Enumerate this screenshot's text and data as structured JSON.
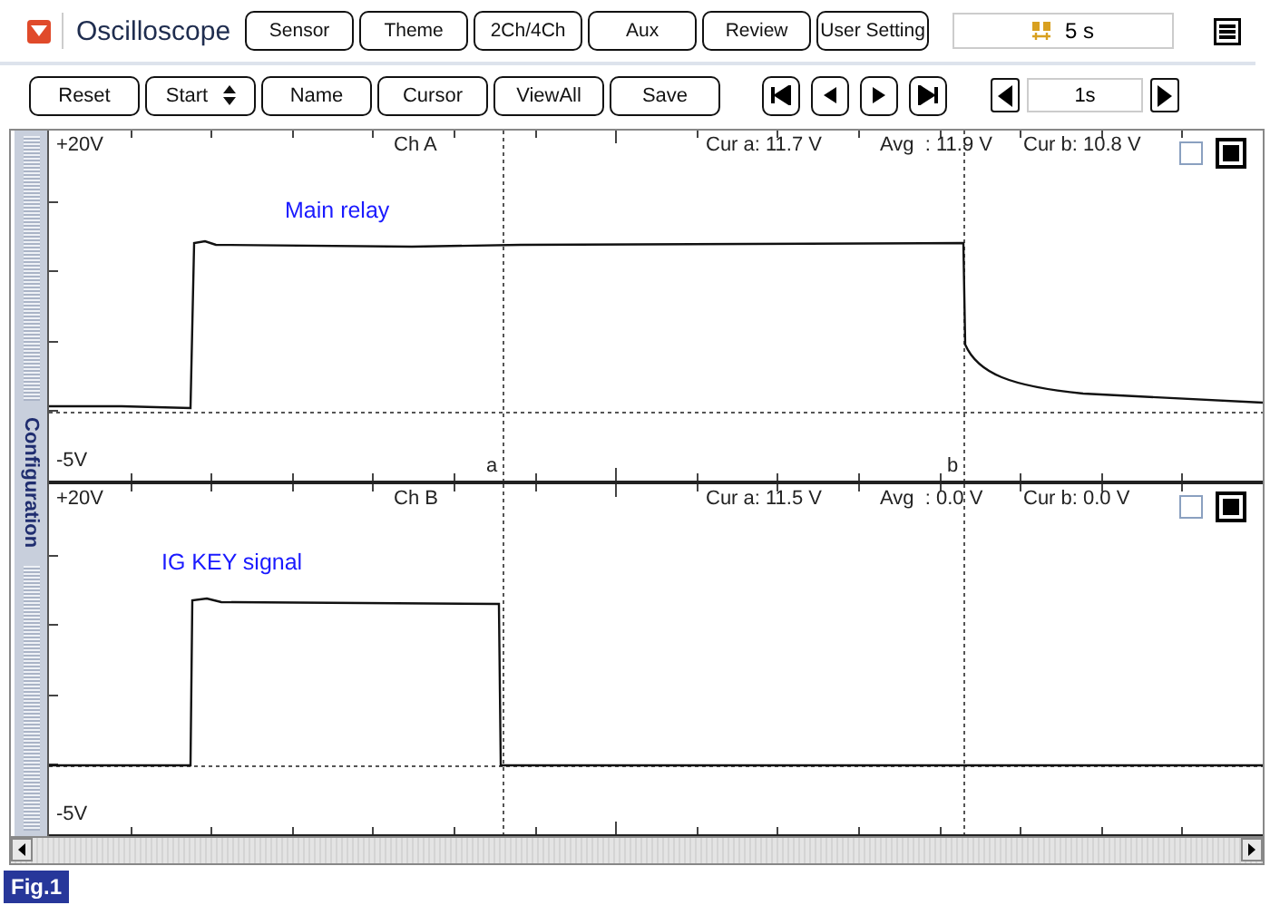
{
  "header": {
    "title": "Oscilloscope"
  },
  "top_buttons": [
    "Sensor",
    "Theme",
    "2Ch/4Ch",
    "Aux",
    "Review",
    "User Setting"
  ],
  "time_display": "5 s",
  "controls": [
    {
      "label": "Reset",
      "kind": "plain"
    },
    {
      "label": "Start",
      "kind": "spinner"
    },
    {
      "label": "Name",
      "kind": "plain"
    },
    {
      "label": "Cursor",
      "kind": "plain"
    },
    {
      "label": "ViewAll",
      "kind": "plain"
    },
    {
      "label": "Save",
      "kind": "plain"
    }
  ],
  "time_step": {
    "value": "1s"
  },
  "sidebar": {
    "label": "Configuration"
  },
  "channels": [
    {
      "channel": "Ch A",
      "y_max": "+20V",
      "y_min": "-5V",
      "cursor_a": "Cur a: 11.7 V",
      "average": "Avg  : 11.9 V",
      "cursor_b": "Cur b: 10.8 V",
      "signal_label": "Main relay",
      "cursor_marks": [
        "a",
        "b"
      ],
      "checkboxes": [
        {
          "checked": false
        },
        {
          "checked": true
        }
      ]
    },
    {
      "channel": "Ch B",
      "y_max": "+20V",
      "y_min": "-5V",
      "cursor_a": "Cur a: 11.5 V",
      "average": "Avg  : 0.0 V",
      "cursor_b": "Cur b: 0.0 V",
      "signal_label": "IG KEY signal",
      "checkboxes": [
        {
          "checked": false
        },
        {
          "checked": true
        }
      ]
    }
  ],
  "figure_label": "Fig.1"
}
